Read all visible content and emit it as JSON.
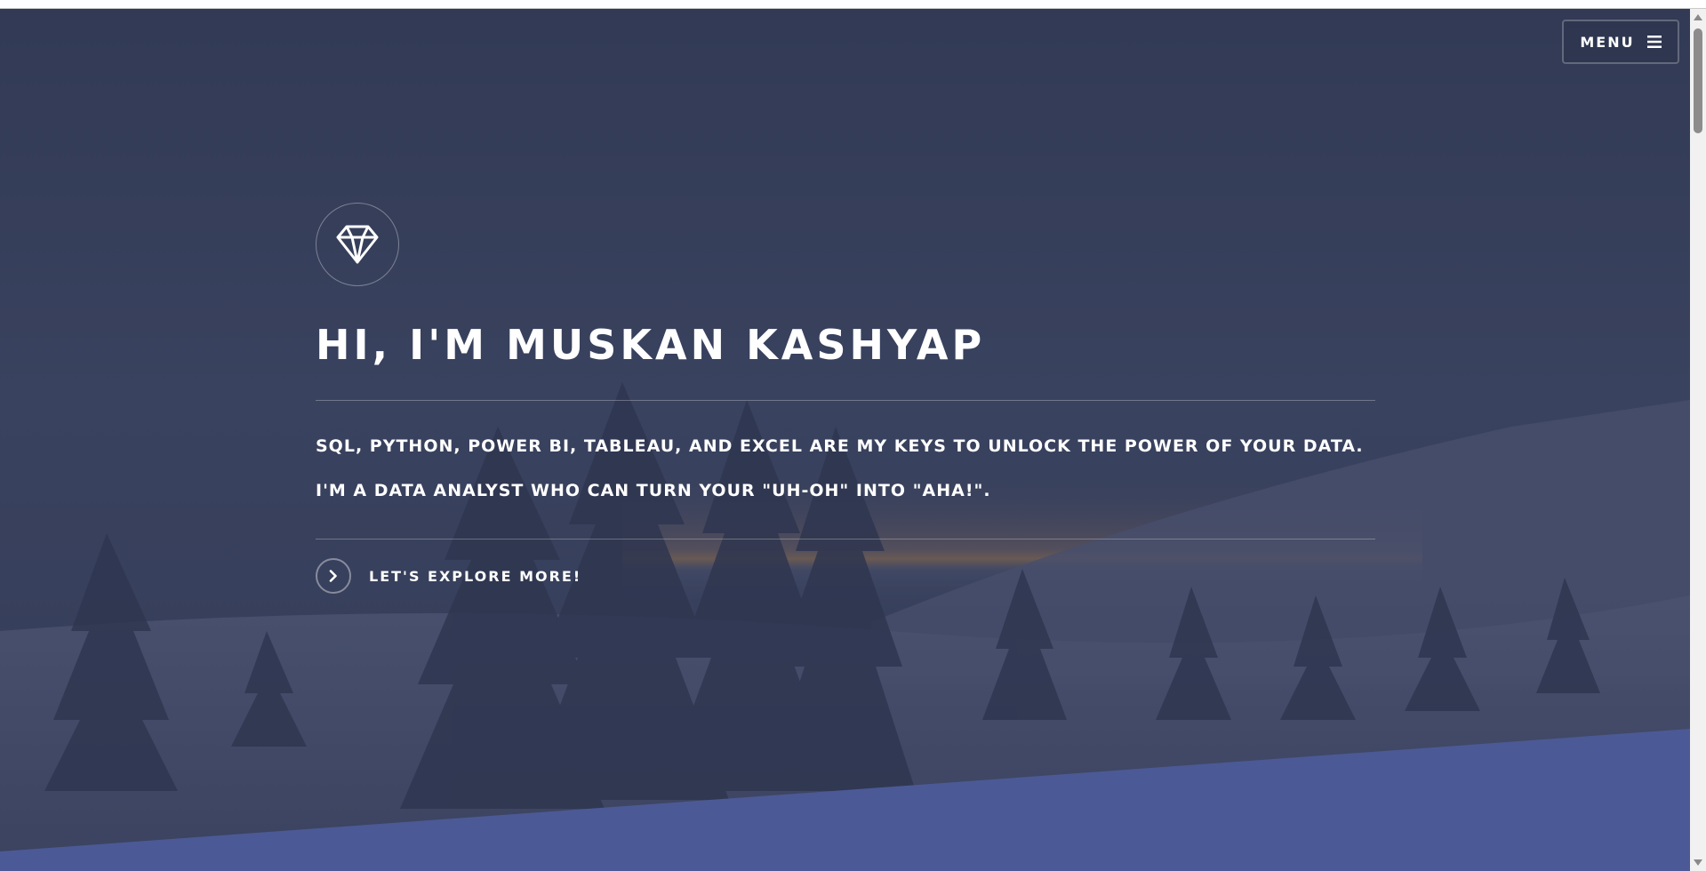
{
  "header": {
    "menu_label": "MENU",
    "menu_icon": "hamburger-icon"
  },
  "hero": {
    "logo_icon": "diamond-icon",
    "title": "HI, I'M MUSKAN KASHYAP",
    "tagline_1": "SQL, PYTHON, POWER BI, TABLEAU, AND EXCEL ARE MY KEYS TO UNLOCK THE POWER OF YOUR DATA.",
    "tagline_2": "I'M A DATA ANALYST WHO CAN TURN YOUR \"UH-OH\" INTO \"AHA!\".",
    "cta_label": "LET'S EXPLORE MORE!",
    "cta_icon": "chevron-right-icon"
  },
  "colors": {
    "overlay": "#343c58",
    "accent_band": "#4b5a96",
    "text": "#ffffff"
  }
}
